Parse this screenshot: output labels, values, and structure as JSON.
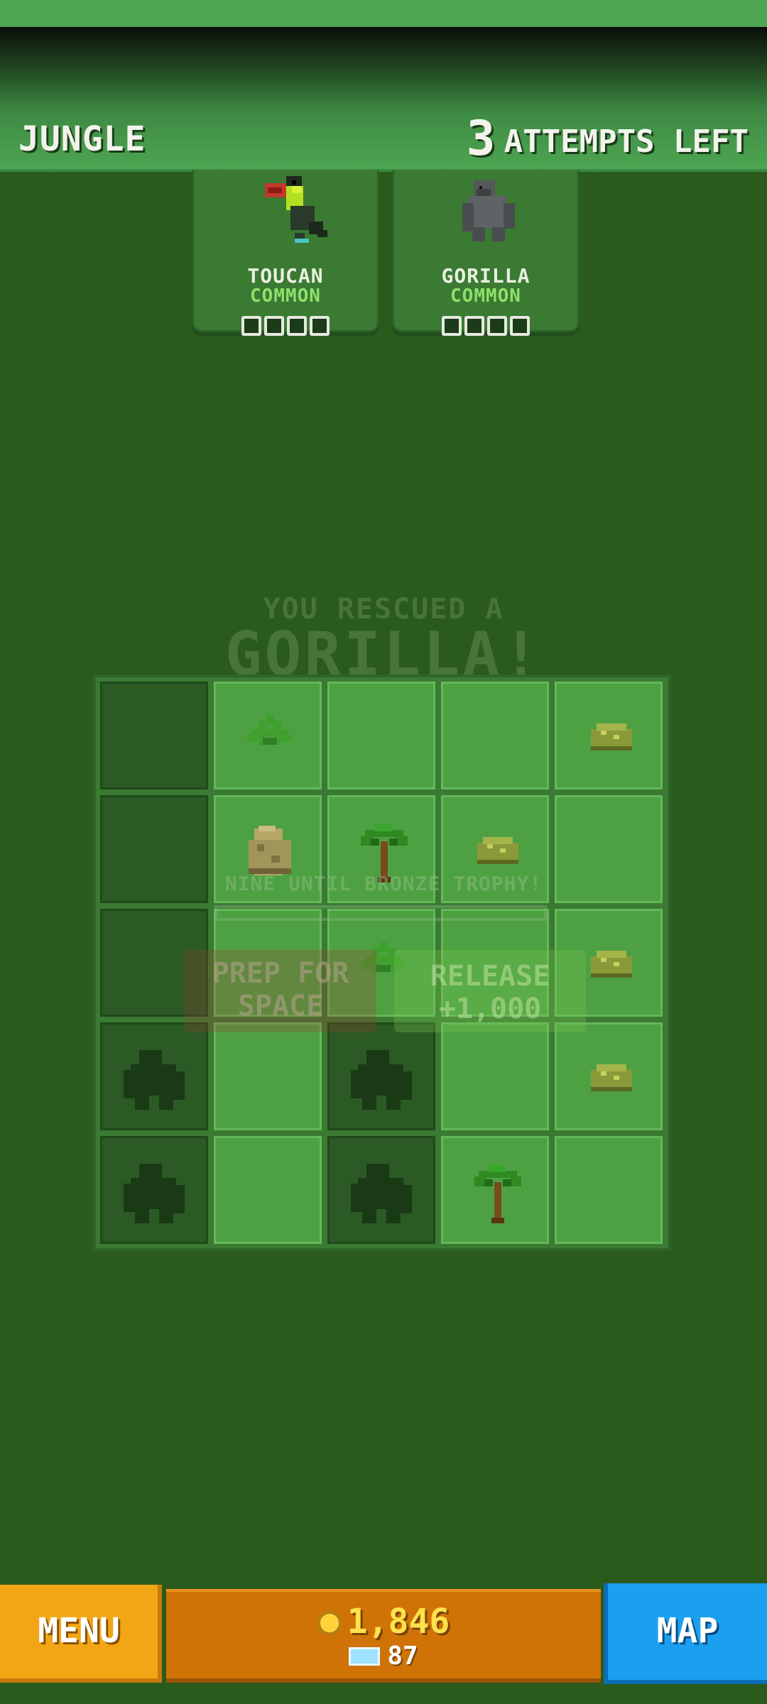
{
  "header": {
    "region": "JUNGLE",
    "attempts_count": "3",
    "attempts_label": "ATTEMPTS LEFT"
  },
  "cards": [
    {
      "name": "TOUCAN",
      "rarity": "COMMON",
      "icon": "toucan-icon",
      "slots_filled": 0,
      "slots_total": 4
    },
    {
      "name": "GORILLA",
      "rarity": "COMMON",
      "icon": "gorilla-icon",
      "slots_filled": 0,
      "slots_total": 4
    }
  ],
  "overlay": {
    "title_line1": "YOU RESCUED A",
    "title_line2": "GORILLA!",
    "progress_text": "NINE UNTIL BRONZE TROPHY!",
    "prep_line1": "PREP FOR",
    "prep_line2": "SPACE",
    "release_line1": "RELEASE",
    "release_line2": "+1,000"
  },
  "grid": {
    "rows": 5,
    "cols": 5,
    "tiles": [
      [
        "dark",
        "fern",
        "empty",
        "empty",
        "bush"
      ],
      [
        "dark",
        "rock",
        "palm",
        "bush",
        "empty"
      ],
      [
        "dark",
        "empty",
        "fern",
        "empty",
        "bush"
      ],
      [
        "gorilla",
        "empty",
        "gorilla",
        "empty",
        "bush"
      ],
      [
        "gorilla",
        "empty",
        "gorilla",
        "palm",
        "empty"
      ]
    ]
  },
  "bottom": {
    "menu_label": "MENU",
    "coins": "1,846",
    "tickets": "87",
    "map_label": "MAP"
  },
  "colors": {
    "background": "#2a5a1c",
    "header": "#4ea552",
    "menu": "#f2a615",
    "money_bar": "#cf7307",
    "map": "#1aa0ef",
    "coins_text": "#ffe14a"
  }
}
